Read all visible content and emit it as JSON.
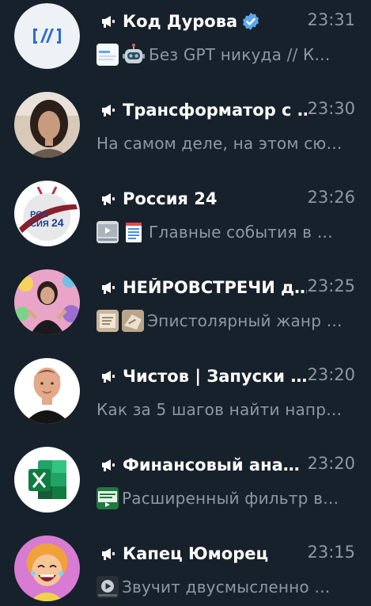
{
  "colors": {
    "background": "#17212b",
    "title": "#ffffff",
    "secondary": "#8d98a3",
    "verified": "#5aa9ef"
  },
  "chats": [
    {
      "title": "Код Дурова",
      "verified": true,
      "time": "23:31",
      "avatar_icon": "kod-durova-logo",
      "thumbs": [
        "article-thumbnail"
      ],
      "emoji": "robot-icon",
      "preview": "Без GPT никуда //  К…"
    },
    {
      "title": "Трансформатор с …",
      "time": "23:30",
      "avatar_icon": "woman-portrait",
      "thumbs": [],
      "preview": "На самом деле, на этом сю…"
    },
    {
      "title": "Россия 24",
      "time": "23:26",
      "avatar_icon": "russia-24-logo",
      "thumbs": [
        "video-thumbnail"
      ],
      "emoji": "memo-icon",
      "preview": "Главные события в …"
    },
    {
      "title": "НЕЙРОВСТРЕЧИ д…",
      "time": "23:25",
      "avatar_icon": "woman-portrait",
      "thumbs": [
        "photo-thumbnail",
        "photo-thumbnail"
      ],
      "preview": "Эпистолярный жанр …"
    },
    {
      "title": "Чистов | Запуски …",
      "time": "23:20",
      "avatar_icon": "man-portrait",
      "thumbs": [],
      "preview": "Как за 5 шагов найти напр…"
    },
    {
      "title": "Финансовый ана…",
      "time": "23:20",
      "avatar_icon": "excel-logo",
      "thumbs": [
        "video-thumbnail"
      ],
      "preview": "Расширенный фильтр в…"
    },
    {
      "title": "Капец Юморец",
      "time": "23:15",
      "avatar_icon": "cartoon-laughing-woman",
      "thumbs": [
        "video-thumbnail"
      ],
      "preview": "Звучит двусмысленно …"
    }
  ]
}
